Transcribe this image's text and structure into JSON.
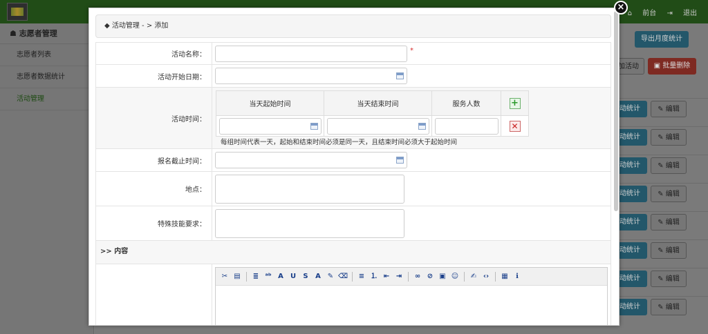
{
  "header": {
    "home_label": "前台",
    "logout_label": "退出"
  },
  "sidebar": {
    "title": "志愿者管理",
    "items": [
      {
        "label": "志愿者列表"
      },
      {
        "label": "志愿者数据统计"
      },
      {
        "label": "活动管理"
      }
    ]
  },
  "background": {
    "export_button": "导出月度统计",
    "add_button": "加活动",
    "batch_delete_button": "批量删除",
    "row_stat_button": "动统计",
    "row_edit_button": "编辑"
  },
  "modal": {
    "breadcrumb": "活动管理  - > 添加",
    "close_icon": "close-icon",
    "fields": {
      "name_label": "活动名称：",
      "name_value": "",
      "required_mark": "*",
      "start_date_label": "活动开始日期：",
      "start_date_value": "",
      "time_label": "活动时间：",
      "deadline_label": "报名截止时间：",
      "deadline_value": "",
      "location_label": "地点：",
      "location_value": "",
      "skills_label": "特殊技能要求：",
      "skills_value": ""
    },
    "time_table": {
      "headers": [
        "当天起始时间",
        "当天结束时间",
        "服务人数"
      ],
      "rows": [
        {
          "start": "",
          "end": "",
          "count": ""
        }
      ],
      "hint": "每组时间代表一天，起始和结束时间必须是同一天，且结束时间必须大于起始时间"
    },
    "content_section_label": ">> 内容",
    "editor": {
      "toolbar": [
        "cut-icon",
        "paste-icon",
        "format-icon",
        "spellcheck-icon",
        "font-icon",
        "underline-icon",
        "strikethrough-icon",
        "font-color-icon",
        "highlight-icon",
        "eraser-icon",
        "align-left-icon",
        "numbered-list-icon",
        "outdent-icon",
        "indent-icon",
        "link-icon",
        "unlink-icon",
        "image-icon",
        "emoticon-icon",
        "edit-icon",
        "source-code-icon",
        "table-icon",
        "info-icon"
      ],
      "toolbar_glyphs": [
        "✂",
        "▤",
        "≣",
        "ᵃᵇ",
        "A",
        "U",
        "S",
        "A",
        "✎",
        "⌫",
        "≡",
        "⒈",
        "⇤",
        "⇥",
        "∞",
        "⊘",
        "▣",
        "☺",
        "✍",
        "‹›",
        "▦",
        "ℹ"
      ]
    }
  },
  "colors": {
    "accent_blue": "#2d8bb0",
    "danger_red": "#d9534f",
    "required_red": "#d62b2b",
    "topbar_green": "#3a8a28"
  }
}
